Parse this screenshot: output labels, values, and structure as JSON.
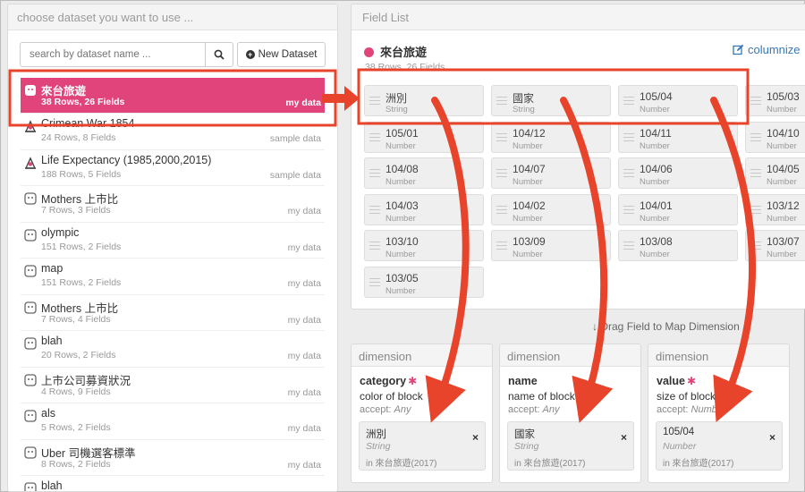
{
  "left_panel": {
    "title": "choose dataset you want to use ...",
    "search_placeholder": "search by dataset name ...",
    "new_dataset_label": "New Dataset",
    "datasets": [
      {
        "name": "來台旅遊",
        "meta": "38 Rows, 26 Fields",
        "tag": "my data",
        "icon": "user-data-icon",
        "selected": true
      },
      {
        "name": "Crimean War 1854",
        "meta": "24 Rows, 8 Fields",
        "tag": "sample data",
        "icon": "sample-data-icon"
      },
      {
        "name": "Life Expectancy (1985,2000,2015)",
        "meta": "188 Rows, 5 Fields",
        "tag": "sample data",
        "icon": "sample-data-icon"
      },
      {
        "name": "Mothers 上市比",
        "meta": "7 Rows, 3 Fields",
        "tag": "my data",
        "icon": "user-data-icon"
      },
      {
        "name": "olympic",
        "meta": "151 Rows, 2 Fields",
        "tag": "my data",
        "icon": "user-data-icon"
      },
      {
        "name": "map",
        "meta": "151 Rows, 2 Fields",
        "tag": "my data",
        "icon": "user-data-icon"
      },
      {
        "name": "Mothers 上市比",
        "meta": "7 Rows, 4 Fields",
        "tag": "my data",
        "icon": "user-data-icon"
      },
      {
        "name": "blah",
        "meta": "20 Rows, 2 Fields",
        "tag": "my data",
        "icon": "user-data-icon"
      },
      {
        "name": "上市公司募資狀況",
        "meta": "4 Rows, 9 Fields",
        "tag": "my data",
        "icon": "user-data-icon"
      },
      {
        "name": "als",
        "meta": "5 Rows, 2 Fields",
        "tag": "my data",
        "icon": "user-data-icon"
      },
      {
        "name": "Uber 司機選客標準",
        "meta": "8 Rows, 2 Fields",
        "tag": "my data",
        "icon": "user-data-icon"
      },
      {
        "name": "blah",
        "meta": "",
        "tag": "",
        "icon": "user-data-icon"
      }
    ]
  },
  "field_panel": {
    "title": "Field List",
    "dataset_name": "來台旅遊",
    "dataset_meta": "38 Rows, 26 Fields",
    "columnize_label": "columnize",
    "fields": [
      {
        "name": "洲別",
        "type": "String"
      },
      {
        "name": "國家",
        "type": "String"
      },
      {
        "name": "105/04",
        "type": "Number"
      },
      {
        "name": "105/03",
        "type": "Number"
      },
      {
        "name": "105/01",
        "type": "Number"
      },
      {
        "name": "104/12",
        "type": "Number"
      },
      {
        "name": "104/11",
        "type": "Number"
      },
      {
        "name": "104/10",
        "type": "Number"
      },
      {
        "name": "104/08",
        "type": "Number"
      },
      {
        "name": "104/07",
        "type": "Number"
      },
      {
        "name": "104/06",
        "type": "Number"
      },
      {
        "name": "104/05",
        "type": "Number"
      },
      {
        "name": "104/03",
        "type": "Number"
      },
      {
        "name": "104/02",
        "type": "Number"
      },
      {
        "name": "104/01",
        "type": "Number"
      },
      {
        "name": "103/12",
        "type": "Number"
      },
      {
        "name": "103/10",
        "type": "Number"
      },
      {
        "name": "103/09",
        "type": "Number"
      },
      {
        "name": "103/08",
        "type": "Number"
      },
      {
        "name": "103/07",
        "type": "Number"
      },
      {
        "name": "103/05",
        "type": "Number"
      }
    ]
  },
  "drag_hint": "Drag Field to Map Dimension",
  "dimensions": [
    {
      "header": "dimension",
      "name": "category",
      "required": "✱",
      "desc": "color of block",
      "accept_label": "accept:",
      "accept": "Any",
      "chip": {
        "name": "洲別",
        "type": "String",
        "source": "in 來台旅遊(2017)"
      }
    },
    {
      "header": "dimension",
      "name": "name",
      "required": "",
      "desc": "name of block",
      "accept_label": "accept:",
      "accept": "Any",
      "chip": {
        "name": "國家",
        "type": "String",
        "source": "in 來台旅遊(2017)"
      }
    },
    {
      "header": "dimension",
      "name": "value",
      "required": "✱",
      "desc": "size of block",
      "accept_label": "accept:",
      "accept": "Number",
      "chip": {
        "name": "105/04",
        "type": "Number",
        "source": "in 來台旅遊(2017)"
      }
    }
  ],
  "colors": {
    "accent": "#e0447b",
    "annotation": "#e8432b",
    "link": "#3a78b5"
  }
}
